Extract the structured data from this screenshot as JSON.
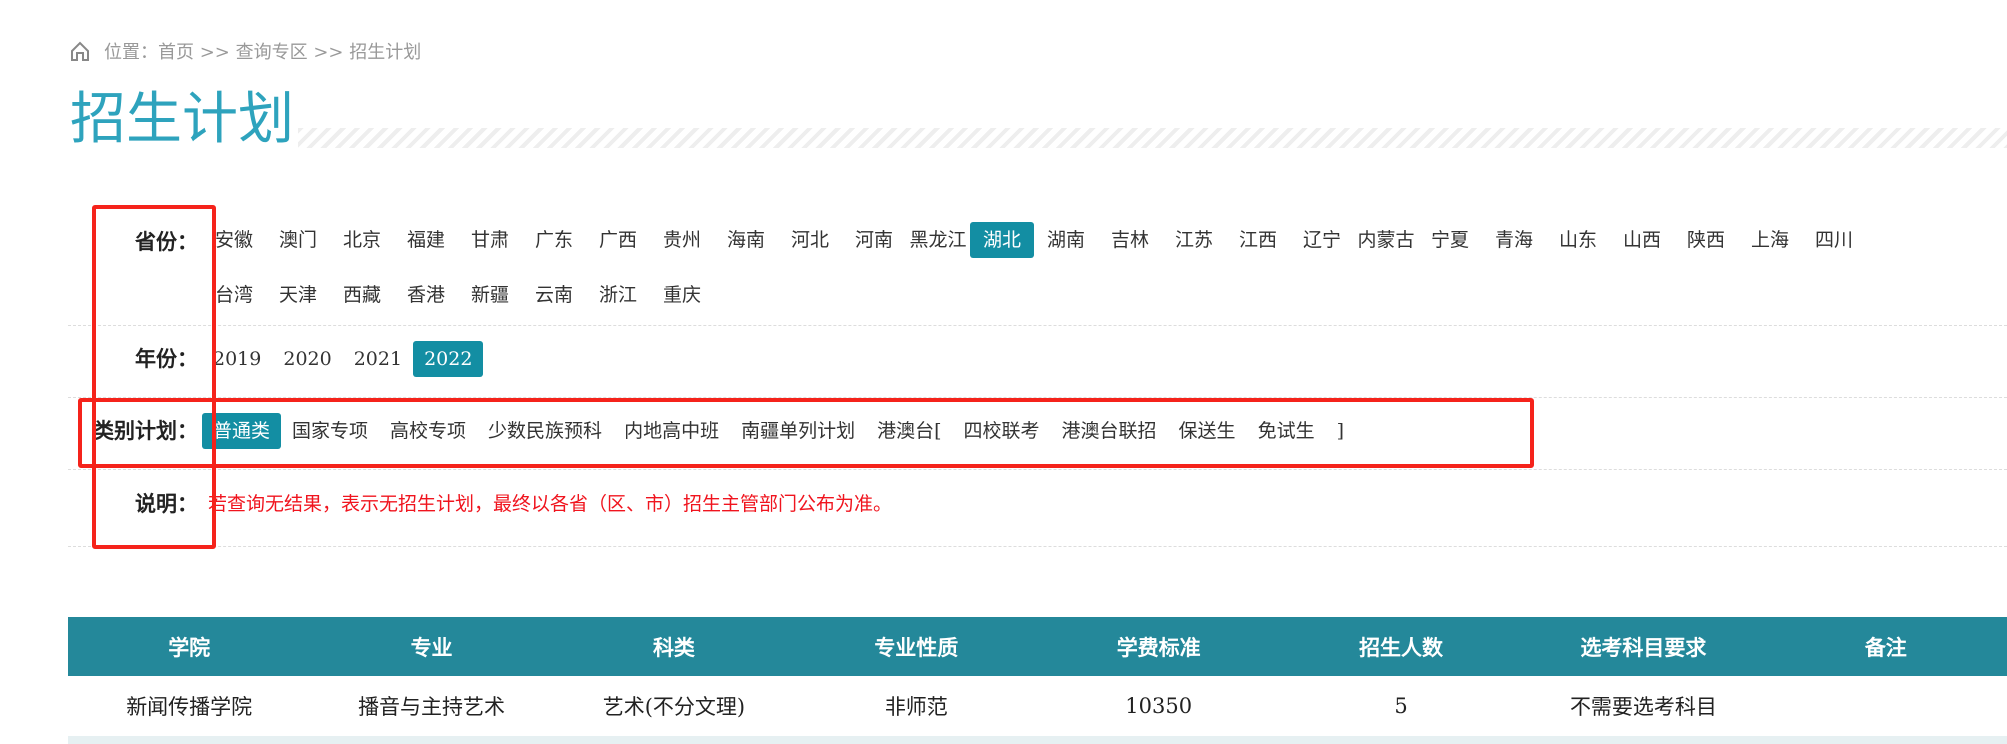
{
  "breadcrumb": {
    "icon": "home-icon",
    "text": "位置：首页 >> 查询专区 >> 招生计划"
  },
  "title": "招生计划",
  "filters": {
    "province": {
      "label": "省份：",
      "items": [
        "安徽",
        "澳门",
        "北京",
        "福建",
        "甘肃",
        "广东",
        "广西",
        "贵州",
        "海南",
        "河北",
        "河南",
        "黑龙江",
        "湖北",
        "湖南",
        "吉林",
        "江苏",
        "江西",
        "辽宁",
        "内蒙古",
        "宁夏",
        "青海",
        "山东",
        "山西",
        "陕西",
        "上海",
        "四川",
        "台湾",
        "天津",
        "西藏",
        "香港",
        "新疆",
        "云南",
        "浙江",
        "重庆"
      ],
      "selected": "湖北"
    },
    "year": {
      "label": "年份：",
      "items": [
        "2019",
        "2020",
        "2021",
        "2022"
      ],
      "selected": "2022"
    },
    "category": {
      "label": "类别计划：",
      "items": [
        "普通类",
        "国家专项",
        "高校专项",
        "少数民族预科",
        "内地高中班",
        "南疆单列计划",
        "港澳台[",
        "四校联考",
        "港澳台联招",
        "保送生",
        "免试生",
        "]"
      ],
      "selected": "普通类"
    },
    "note": {
      "label": "说明：",
      "text": "若查询无结果，表示无招生计划，最终以各省（区、市）招生主管部门公布为准。"
    }
  },
  "table": {
    "headers": [
      "学院",
      "专业",
      "科类",
      "专业性质",
      "学费标准",
      "招生人数",
      "选考科目要求",
      "备注"
    ],
    "rows": [
      [
        "新闻传播学院",
        "播音与主持艺术",
        "艺术(不分文理)",
        "非师范",
        "10350",
        "5",
        "不需要选考科目",
        ""
      ]
    ]
  },
  "colors": {
    "accent": "#138ea3",
    "header": "#24889a",
    "highlight": "#f5231b"
  }
}
